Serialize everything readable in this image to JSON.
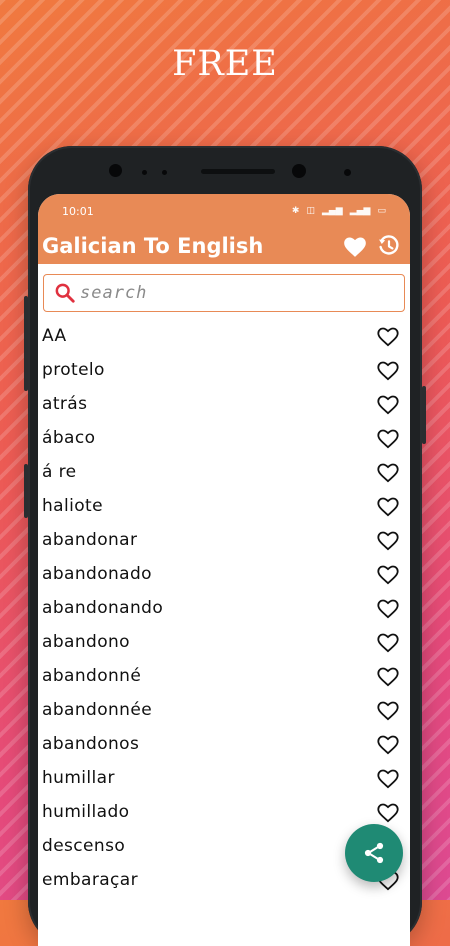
{
  "banner": {
    "text": "FREE"
  },
  "status_bar": {
    "time": "10:01"
  },
  "app": {
    "title": "Galician To English"
  },
  "search": {
    "placeholder": "search"
  },
  "words": [
    "AA",
    "protelo",
    "atrás",
    "ábaco",
    "á re",
    "haliote",
    "abandonar",
    "abandonado",
    "abandonando",
    "abandono",
    "abandonné",
    "abandonnée",
    "abandonos",
    "humillar",
    "humillado",
    "descenso",
    "embaraçar"
  ],
  "colors": {
    "header": "#e88a56",
    "fab": "#1f8a74",
    "search_icon": "#e0313f"
  },
  "icons": {
    "header_favorites": "heart-filled-icon",
    "header_history": "history-icon",
    "search": "search-icon",
    "row_favorite": "heart-outline-icon",
    "fab": "share-icon"
  }
}
